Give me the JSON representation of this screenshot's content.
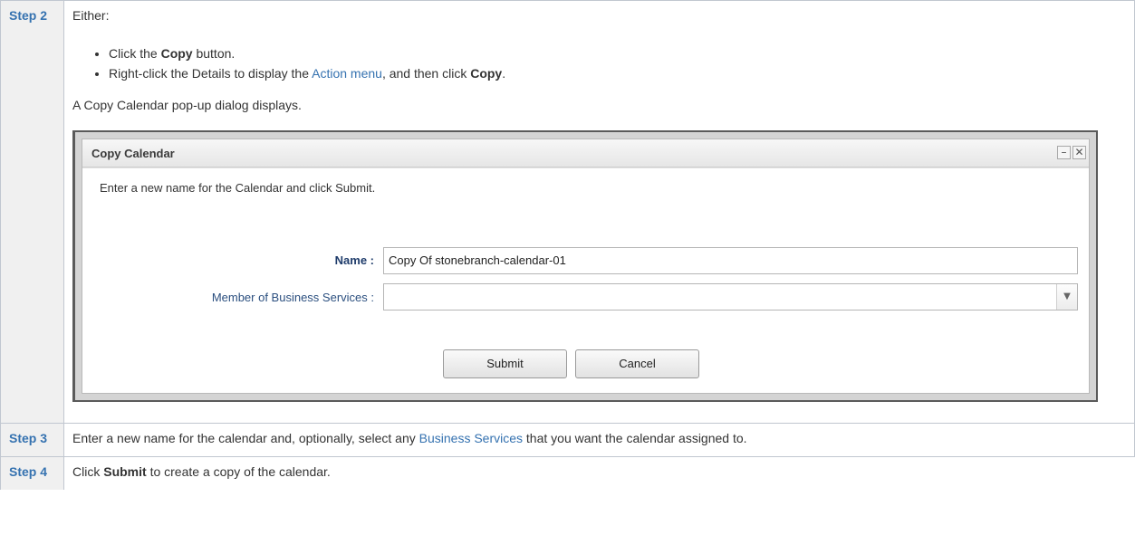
{
  "steps": [
    {
      "label": "Step 2",
      "intro": "Either:",
      "bullets": [
        {
          "pre": "Click the ",
          "bold": "Copy",
          "post": " button."
        },
        {
          "pre": "Right-click the Details to display the ",
          "link": "Action menu",
          "mid": ", and then click ",
          "bold": "Copy",
          "post": "."
        }
      ],
      "after": "A Copy Calendar pop-up dialog displays."
    },
    {
      "label": "Step 3",
      "pre": "Enter a new name for the calendar and, optionally, select any ",
      "link": "Business Services",
      "post": " that you want the calendar assigned to."
    },
    {
      "label": "Step 4",
      "pre": "Click ",
      "bold": "Submit",
      "post": " to create a copy of the calendar."
    }
  ],
  "dialog": {
    "title": "Copy Calendar",
    "minimize_glyph": "–",
    "close_glyph": "✕",
    "instructions": "Enter a new name for the Calendar and click Submit.",
    "name_label": "Name :",
    "name_value": "Copy Of stonebranch-calendar-01",
    "member_label": "Member of Business Services :",
    "member_value": "",
    "dropdown_glyph": "▼",
    "submit_label": "Submit",
    "cancel_label": "Cancel"
  },
  "colors": {
    "link": "#3572b0",
    "step_label_bg": "#f0f0f0"
  }
}
